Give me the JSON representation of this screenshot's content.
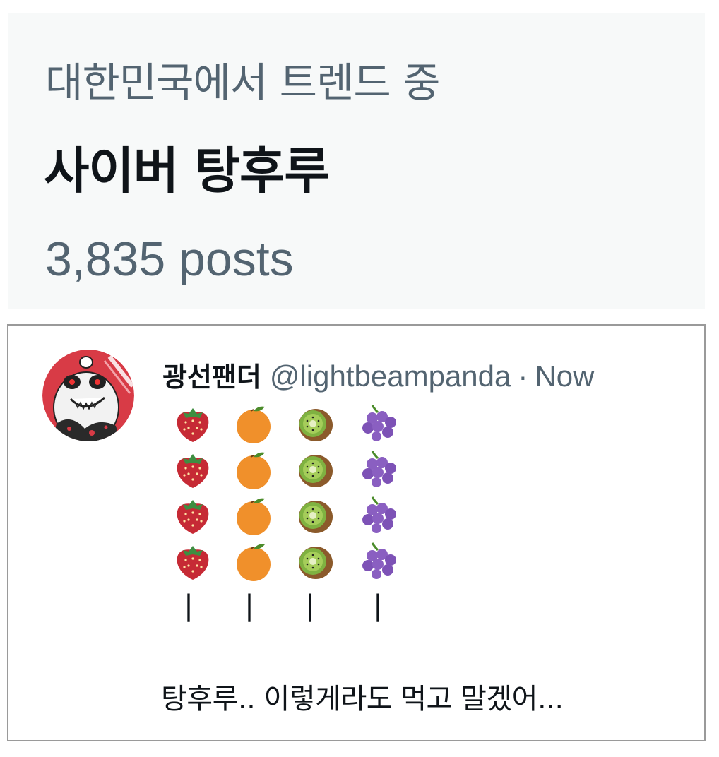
{
  "trend": {
    "context": "대한민국에서 트렌드 중",
    "title": "사이버 탕후루",
    "post_count": "3,835 posts"
  },
  "post": {
    "display_name": "광선팬더",
    "handle": "@lightbeampanda",
    "separator": "·",
    "timestamp": "Now",
    "emoji_rows": [
      [
        "strawberry",
        "orange",
        "kiwi",
        "grapes"
      ],
      [
        "strawberry",
        "orange",
        "kiwi",
        "grapes"
      ],
      [
        "strawberry",
        "orange",
        "kiwi",
        "grapes"
      ],
      [
        "strawberry",
        "orange",
        "kiwi",
        "grapes"
      ]
    ],
    "skewers": [
      "|",
      "|",
      "|",
      "|"
    ],
    "text": "탕후루.. 이렇게라도 먹고 말겠어..."
  },
  "colors": {
    "trend_bg": "#f7f9f9",
    "secondary_text": "#536471",
    "primary_text": "#0f1419",
    "avatar_bg": "#d83b46"
  }
}
